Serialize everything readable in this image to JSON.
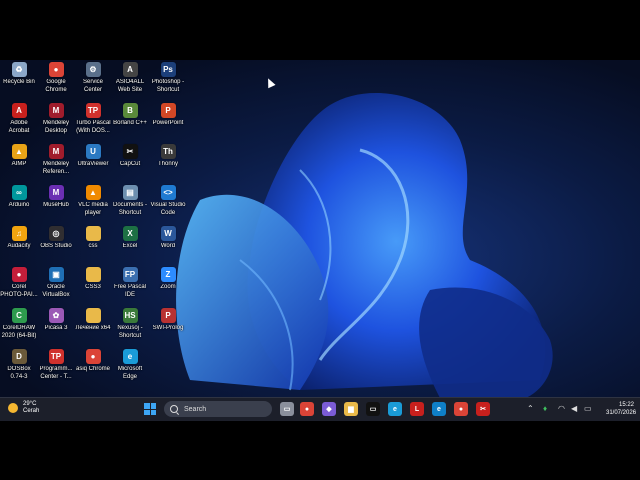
{
  "desktop": {
    "icons": [
      {
        "label": "Recycle Bin",
        "icon": "recycle-bin-icon",
        "color": "#8aa6c8",
        "glyph": "♻"
      },
      {
        "label": "Google Chrome",
        "icon": "chrome-icon",
        "color": "#db4437",
        "glyph": "●"
      },
      {
        "label": "Service Center",
        "icon": "service-center-icon",
        "color": "#5a6f8a",
        "glyph": "⚙"
      },
      {
        "label": "ASIO4ALL Web Site",
        "icon": "asio4all-icon",
        "color": "#444444",
        "glyph": "A"
      },
      {
        "label": "Photoshop - Shortcut",
        "icon": "photoshop-icon",
        "color": "#1c3f7a",
        "glyph": "Ps"
      },
      {
        "label": "Adobe Acrobat",
        "icon": "acrobat-icon",
        "color": "#c8201d",
        "glyph": "A"
      },
      {
        "label": "Mendeley Desktop",
        "icon": "mendeley-icon",
        "color": "#a01c2c",
        "glyph": "M"
      },
      {
        "label": "Turbo Pascal (With DOS...",
        "icon": "turbo-pascal-icon",
        "color": "#d0312d",
        "glyph": "TP"
      },
      {
        "label": "Borland C++",
        "icon": "borland-icon",
        "color": "#5a8a3a",
        "glyph": "B"
      },
      {
        "label": "PowerPoint",
        "icon": "powerpoint-icon",
        "color": "#d24726",
        "glyph": "P"
      },
      {
        "label": "AIMP",
        "icon": "aimp-icon",
        "color": "#e8a317",
        "glyph": "▲"
      },
      {
        "label": "Mendeley Referen...",
        "icon": "mendeley-reference-icon",
        "color": "#a01c2c",
        "glyph": "M"
      },
      {
        "label": "UltraViewer",
        "icon": "ultraviewer-icon",
        "color": "#2b79c2",
        "glyph": "U"
      },
      {
        "label": "CapCut",
        "icon": "capcut-icon",
        "color": "#111111",
        "glyph": "✂"
      },
      {
        "label": "Thonny",
        "icon": "thonny-icon",
        "color": "#3a3a3a",
        "glyph": "Th"
      },
      {
        "label": "Arduino",
        "icon": "arduino-icon",
        "color": "#00979c",
        "glyph": "∞"
      },
      {
        "label": "MuseHub",
        "icon": "musehub-icon",
        "color": "#6b2fb3",
        "glyph": "M"
      },
      {
        "label": "VLC media player",
        "icon": "vlc-icon",
        "color": "#f08a00",
        "glyph": "▲"
      },
      {
        "label": "Documents - Shortcut",
        "icon": "documents-icon",
        "color": "#6d8fb0",
        "glyph": "▤"
      },
      {
        "label": "Visual Studio Code",
        "icon": "vscode-icon",
        "color": "#1f7ad1",
        "glyph": "<>"
      },
      {
        "label": "Audacity",
        "icon": "audacity-icon",
        "color": "#f2a40f",
        "glyph": "♫"
      },
      {
        "label": "OBS Studio",
        "icon": "obs-icon",
        "color": "#302e31",
        "glyph": "◎"
      },
      {
        "label": "css",
        "icon": "folder-icon",
        "color": "#e9b949",
        "glyph": ""
      },
      {
        "label": "Excel",
        "icon": "excel-icon",
        "color": "#1d7044",
        "glyph": "X"
      },
      {
        "label": "Word",
        "icon": "word-icon",
        "color": "#2b579a",
        "glyph": "W"
      },
      {
        "label": "Corel PHOTO-PAI...",
        "icon": "corel-photo-paint-icon",
        "color": "#c41e3a",
        "glyph": "●"
      },
      {
        "label": "Oracle VirtualBox",
        "icon": "virtualbox-icon",
        "color": "#1f6fb5",
        "glyph": "▣"
      },
      {
        "label": "CSS3",
        "icon": "folder-icon",
        "color": "#e9b949",
        "glyph": ""
      },
      {
        "label": "Free Pascal IDE",
        "icon": "free-pascal-icon",
        "color": "#3b6fb0",
        "glyph": "FP"
      },
      {
        "label": "Zoom",
        "icon": "zoom-icon",
        "color": "#2d8cff",
        "glyph": "Z"
      },
      {
        "label": "CorelDRAW 2020 (64-Bit)",
        "icon": "coreldraw-icon",
        "color": "#2e9b4e",
        "glyph": "C"
      },
      {
        "label": "Picasa 3",
        "icon": "picasa-icon",
        "color": "#9b59b6",
        "glyph": "✿"
      },
      {
        "label": "Лечение x64",
        "icon": "folder-icon",
        "color": "#e9b949",
        "glyph": ""
      },
      {
        "label": "Nexusoj - Shortcut",
        "icon": "nexusoj-icon",
        "color": "#3a7a3a",
        "glyph": "HS"
      },
      {
        "label": "SWI-Prolog",
        "icon": "swi-prolog-icon",
        "color": "#b83232",
        "glyph": "P"
      },
      {
        "label": "DOSBox 0.74-3",
        "icon": "dosbox-icon",
        "color": "#6b5a3a",
        "glyph": "D"
      },
      {
        "label": "Programm... Center - T...",
        "icon": "program-center-icon",
        "color": "#d0312d",
        "glyph": "TP"
      },
      {
        "label": "asiq Chrome",
        "icon": "chrome-icon",
        "color": "#db4437",
        "glyph": "●"
      },
      {
        "label": "Microsoft Edge",
        "icon": "edge-icon",
        "color": "#1a9bd7",
        "glyph": "e"
      }
    ]
  },
  "taskbar": {
    "weather_temp": "29°C",
    "weather_desc": "Cerah",
    "search_placeholder": "Search",
    "apps": [
      {
        "name": "task-view-icon",
        "color": "#8a8f9c",
        "glyph": "▭"
      },
      {
        "name": "chrome-icon",
        "color": "#db4437",
        "glyph": "●"
      },
      {
        "name": "copilot-icon",
        "color": "#7b5cd6",
        "glyph": "◆"
      },
      {
        "name": "file-explorer-icon",
        "color": "#e9b949",
        "glyph": "▆"
      },
      {
        "name": "terminal-icon",
        "color": "#111111",
        "glyph": "▭"
      },
      {
        "name": "edge-icon",
        "color": "#1a9bd7",
        "glyph": "e"
      },
      {
        "name": "lwks-icon",
        "color": "#c8201d",
        "glyph": "L"
      },
      {
        "name": "edge-browser-icon",
        "color": "#0f7fc7",
        "glyph": "e"
      },
      {
        "name": "chrome-profile-icon",
        "color": "#db4437",
        "glyph": "●"
      },
      {
        "name": "snipping-tool-icon",
        "color": "#c8201d",
        "glyph": "✂"
      }
    ],
    "clock_time": "15:22",
    "clock_date": "31/07/2026"
  }
}
